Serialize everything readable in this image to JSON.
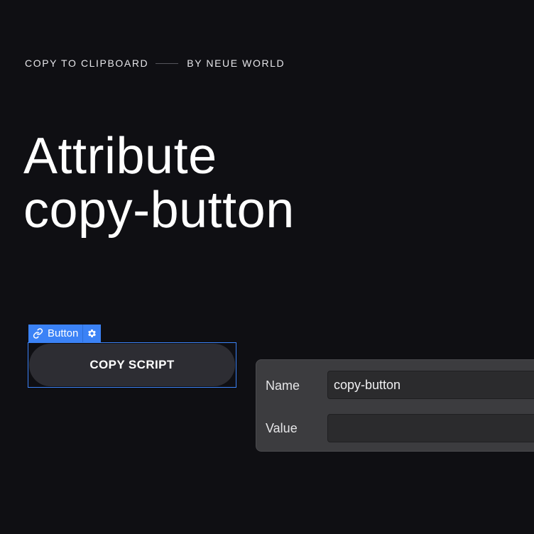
{
  "eyebrow": {
    "left_text": "COPY TO CLIPBOARD",
    "right_text": "BY NEUE WORLD"
  },
  "headline": {
    "line1": "Attribute",
    "line2": "copy-button"
  },
  "element_tag": {
    "label": "Button",
    "link_icon": "link-icon",
    "gear_icon": "gear-icon",
    "color": "#3b82f6"
  },
  "button": {
    "label": "COPY SCRIPT"
  },
  "attribute_panel": {
    "name_label": "Name",
    "name_value": "copy-button",
    "value_label": "Value",
    "value_value": ""
  },
  "colors": {
    "background": "#0f0f13",
    "accent": "#3b82f6",
    "button_bg": "#2d2d33",
    "panel_bg": "#3c3c3f"
  }
}
